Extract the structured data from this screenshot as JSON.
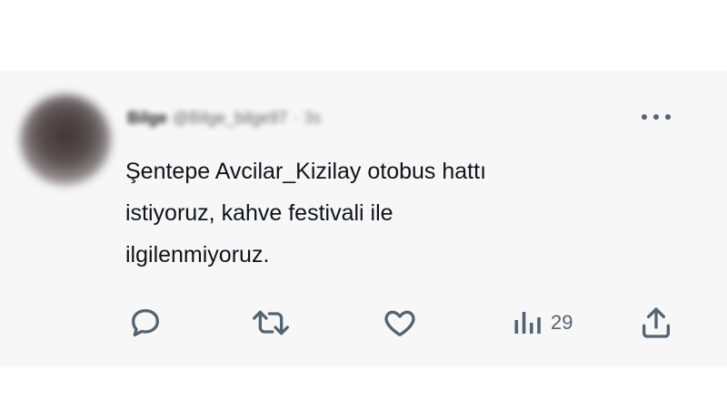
{
  "tweet": {
    "author_name": "Bilge",
    "author_handle": "@Bilge_bilge97",
    "separator": "·",
    "time": "3s",
    "text": "Şentepe Avcilar_Kizilay otobus hattı\nistiyoruz,  kahve festivali ile\nilgilenmiyoruz."
  },
  "actions": {
    "reply_icon": "reply-icon",
    "retweet_icon": "retweet-icon",
    "like_icon": "heart-icon",
    "views_icon": "views-icon",
    "views_count": "29",
    "share_icon": "share-icon",
    "more_icon": "more-icon"
  },
  "colors": {
    "card_background": "#f7f7f7",
    "icon_color": "#536471",
    "text_color": "#0f1419"
  }
}
